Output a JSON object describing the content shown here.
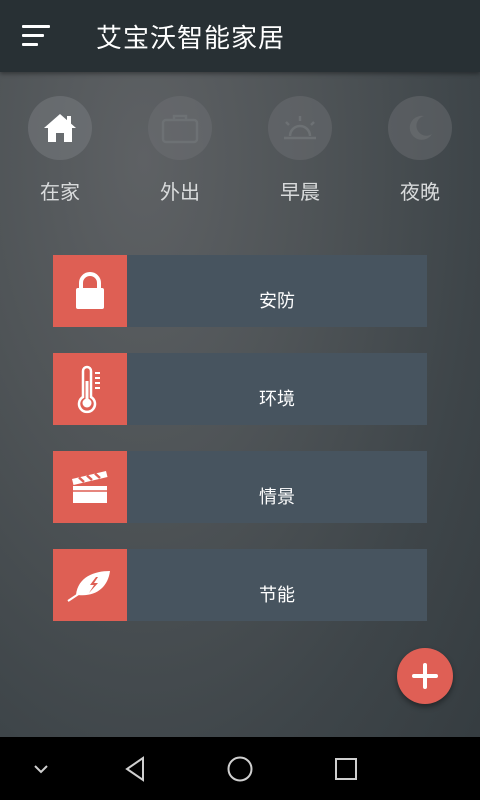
{
  "app": {
    "title": "艾宝沃智能家居"
  },
  "modes": [
    {
      "label": "在家",
      "icon": "home-icon",
      "active": true
    },
    {
      "label": "外出",
      "icon": "briefcase-icon",
      "active": false
    },
    {
      "label": "早晨",
      "icon": "sunrise-icon",
      "active": false
    },
    {
      "label": "夜晚",
      "icon": "moon-icon",
      "active": false
    }
  ],
  "cards": [
    {
      "label": "安防",
      "icon": "lock-icon"
    },
    {
      "label": "环境",
      "icon": "thermometer-icon"
    },
    {
      "label": "情景",
      "icon": "clapperboard-icon"
    },
    {
      "label": "节能",
      "icon": "leaf-bolt-icon"
    }
  ],
  "fab": {
    "icon": "plus-icon"
  },
  "navbar": {
    "icons": [
      "chevron-down-icon",
      "back-icon",
      "home-circle-icon",
      "recent-apps-icon"
    ]
  },
  "colors": {
    "appbar": "#283034",
    "card": "#47545f",
    "accent": "#de5f54",
    "text": "#ffffff",
    "mode_label": "#d9dbdc"
  }
}
